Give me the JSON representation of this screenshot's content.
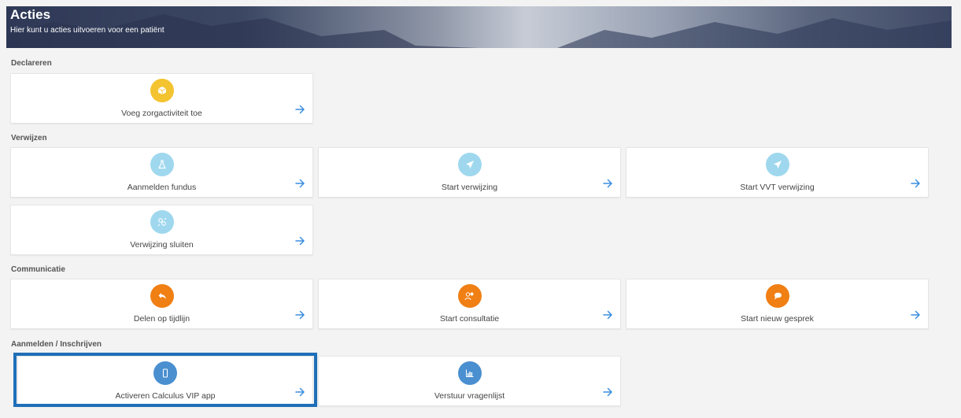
{
  "header": {
    "title": "Acties",
    "subtitle": "Hier kunt u acties uitvoeren voor een patiënt"
  },
  "sections": {
    "declareren": "Declareren",
    "verwijzen": "Verwijzen",
    "communicatie": "Communicatie",
    "aanmelden": "Aanmelden / Inschrijven"
  },
  "cards": {
    "zorgactiviteit": "Voeg zorgactiviteit toe",
    "fundus": "Aanmelden fundus",
    "verwijzing": "Start verwijzing",
    "vvt": "Start VVT verwijzing",
    "sluiten": "Verwijzing sluiten",
    "tijdlijn": "Delen op tijdlijn",
    "consultatie": "Start consultatie",
    "gesprek": "Start nieuw gesprek",
    "calculus": "Activeren Calculus VIP app",
    "vragenlijst": "Verstuur vragenlijst"
  },
  "colors": {
    "yellow": "#f3c330",
    "light_blue": "#9fd8ee",
    "orange": "#f07f14",
    "blue": "#4a8fd0",
    "arrow": "#3a8de0",
    "highlight": "#1f6fb8"
  },
  "icons": {
    "zorgactiviteit": "cube-icon",
    "fundus": "flask-icon",
    "verwijzing": "paper-plane-icon",
    "vvt": "paper-plane-icon",
    "sluiten": "unlink-icon",
    "tijdlijn": "reply-icon",
    "consultatie": "users-icon",
    "gesprek": "chat-icon",
    "calculus": "mobile-icon",
    "vragenlijst": "bar-chart-icon"
  }
}
